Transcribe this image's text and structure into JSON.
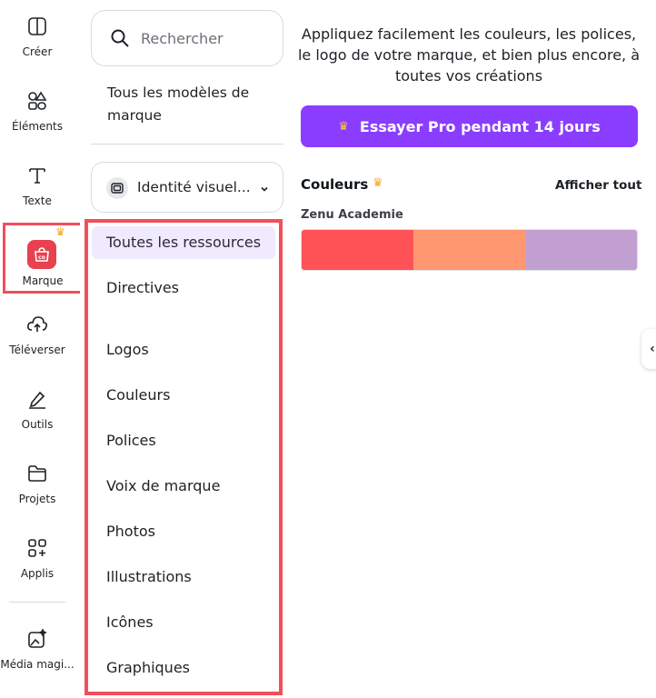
{
  "rail": {
    "items": [
      {
        "label": "Créer",
        "icon": "create-icon"
      },
      {
        "label": "Éléments",
        "icon": "elements-icon"
      },
      {
        "label": "Texte",
        "icon": "text-icon"
      },
      {
        "label": "Marque",
        "icon": "brand-icon"
      },
      {
        "label": "Téléverser",
        "icon": "upload-cloud-icon"
      },
      {
        "label": "Outils",
        "icon": "pen-tool-icon"
      },
      {
        "label": "Projets",
        "icon": "folder-icon"
      },
      {
        "label": "Applis",
        "icon": "apps-icon"
      },
      {
        "label": "Média magi...",
        "icon": "magic-media-icon"
      }
    ]
  },
  "panel": {
    "search_placeholder": "Rechercher",
    "all_templates": "Tous les modèles de marque",
    "kit_selector": "Identité visuel...",
    "resources": [
      "Toutes les ressources",
      "Directives",
      "Logos",
      "Couleurs",
      "Polices",
      "Voix de marque",
      "Photos",
      "Illustrations",
      "Icônes",
      "Graphiques"
    ]
  },
  "main": {
    "intro": "Appliquez facilement les couleurs, les polices, le logo de votre marque, et bien plus encore, à toutes vos créations",
    "pro_button": "Essayer Pro pendant 14 jours",
    "colors_title": "Couleurs",
    "show_all": "Afficher tout",
    "kit_name": "Zenu Academie",
    "swatches": [
      "#ff5257",
      "#ff9870",
      "#c29fd1"
    ]
  },
  "colors": {
    "accent_purple": "#8b3dff",
    "highlight_red": "#f24e5c",
    "crown": "#f6a623"
  }
}
